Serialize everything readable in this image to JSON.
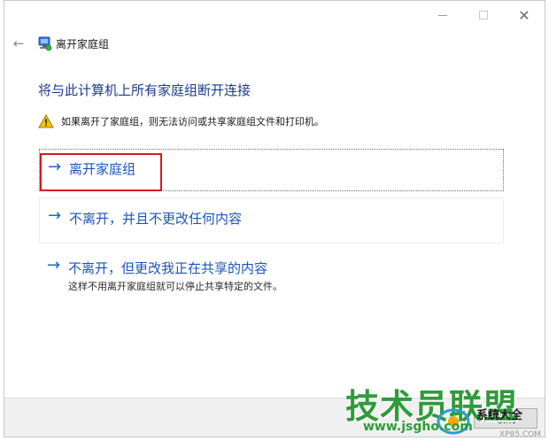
{
  "window": {
    "title": "离开家庭组",
    "caption": {
      "minimize": "—",
      "maximize": "☐",
      "close": "✕"
    }
  },
  "header": {
    "back": "←"
  },
  "page": {
    "title": "将与此计算机上所有家庭组断开连接",
    "warning": "如果离开了家庭组，则无法访问或共享家庭组文件和打印机。"
  },
  "commands": [
    {
      "arrow": "→",
      "label": "离开家庭组"
    },
    {
      "arrow": "→",
      "label": "不离开，并且不更改任何内容"
    },
    {
      "arrow": "→",
      "label": "不离开，但更改我正在共享的内容",
      "description": "这样不用离开家庭组就可以停止共享特定的文件。"
    }
  ],
  "footer": {
    "cancel_label": "取消"
  },
  "watermark": {
    "title": "技术员联盟",
    "url": "www.jsgho.com",
    "small": "系统大全",
    "site": "XP85.COM"
  },
  "colors": {
    "link": "#1a55b8",
    "title": "#1e3a8a",
    "highlight": "#d21a1a",
    "watermark": "#2f9b3a"
  },
  "icons": {
    "back": "back-arrow-icon",
    "homegroup": "homegroup-icon",
    "warning": "warning-icon"
  }
}
